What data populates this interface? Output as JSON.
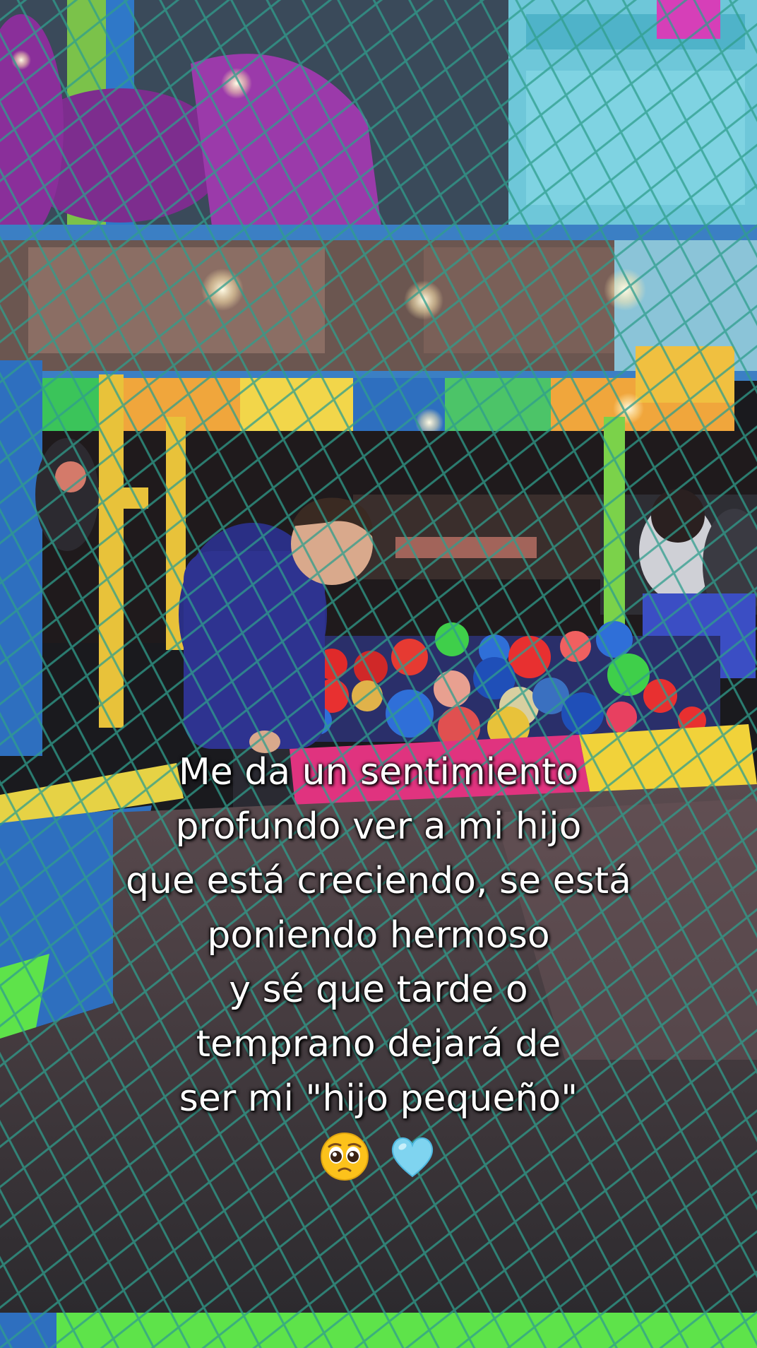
{
  "caption": {
    "lines": [
      "Me da un sentimiento",
      "profundo ver a mi hijo",
      "que está creciendo, se está",
      "poniendo hermoso",
      "y sé que tarde o",
      "temprano dejará de",
      "ser mi \"hijo pequeño\""
    ],
    "emojis": [
      "pleading-face-emoji",
      "light-blue-heart-emoji"
    ]
  },
  "colors": {
    "net": "#2f9d8c",
    "frame_blue": "#3b7fc4",
    "purple_slide": "#8a2f9a",
    "yellow_post": "#e8c23a",
    "pad_magenta": "#e0337f",
    "pad_yellow": "#f1d23a",
    "pad_blue": "#2e6fbf",
    "floor": "#3a3a3e",
    "green_strip": "#5ee34a"
  }
}
